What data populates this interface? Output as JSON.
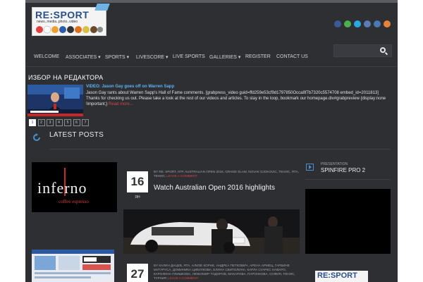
{
  "header": {
    "logo_text": "RE:SPORT",
    "logo_tagline": "news..media..photo..video",
    "social_icons": [
      {
        "name": "facebook-icon",
        "color": "#3b5998"
      },
      {
        "name": "google-plus-icon",
        "color": "#4caf50"
      },
      {
        "name": "twitter-icon",
        "color": "#28a9e0"
      },
      {
        "name": "pinterest-icon",
        "color": "#5b7bb4"
      },
      {
        "name": "linkedin-icon",
        "color": "#4a78b5"
      },
      {
        "name": "rss-icon",
        "color": "#e8823a"
      }
    ]
  },
  "nav": {
    "items": [
      {
        "label": "WELCOME"
      },
      {
        "label": "ASSOCIATES ▾"
      },
      {
        "label": "SPORTS ▾"
      },
      {
        "label": "LIVESCORE ▾"
      },
      {
        "label": "LIVE SPORTS"
      },
      {
        "label": "GALLERIES ▾"
      },
      {
        "label": "REGISTER"
      },
      {
        "label": "CONTACT US"
      }
    ],
    "search_placeholder": ""
  },
  "editor": {
    "section_title": "ИЗБОР НА РЕДАКТОРА",
    "post_title": "VIDEO: Jason Gay goes off on Warren Sapp",
    "post_excerpt": "Jason Gay rants about Warren Sapp's Hall of Fame comments. [grabpress_video guid=ffd259e53cf9d1797850Occa8f7b7320c5574708 embed_id=2011813] Thanks for checking us out. Please take a look at the rest of our videos and articles. To stay in the loop, bookmark our homepage.div#grabpreview {display:none !important;}",
    "read_more": "Read more...",
    "pages": [
      "1",
      "2",
      "3",
      "4",
      "5",
      "6",
      "7"
    ],
    "active_page": "1"
  },
  "latest": {
    "title": "LATEST POSTS"
  },
  "posts": [
    {
      "day": "16",
      "month": "ЯН",
      "meta": "BY RE: SPORT, ATP, AUSTRALIAN OPEN 2016, GRAND SLAM, NOVAK DJOKOVIC, ТЕНИС, ЯТА, ТЕНИС,",
      "meta_link": "LEAVE A COMMENT",
      "title": "Watch Australian Open 2016 highlights"
    },
    {
      "day": "27",
      "month": "",
      "meta": "BY КАЛИН ДАЦЕВ, ЯТА, АЛИЗЕ КОРНЕ, АНДРЕА ПЕТКОВИЧ, АРЕНА АРМЕЦ, ГАРБИНЕ МУГУРУСА, ДОМИНИКА ЦИБУЛКОВА, ЕЛИНА СВИТОЛИНА, КАРЛА СУАРЕС НАВАРО, КАРОЛИНА ПЛИШКОВА, ЛЮБОМИР ТОДОРОВ, МАКАРОВА, ПАРОНКОВА, СОФИЯ, ТЕНИС, ТУРНИР,",
      "meta_link": "LEAVE A COMMENT",
      "title": ""
    }
  ],
  "sidebar": {
    "category": "PRESENTATION",
    "title": "SPINFIRE PRO 2",
    "logo_text": "RE:SPORT"
  }
}
